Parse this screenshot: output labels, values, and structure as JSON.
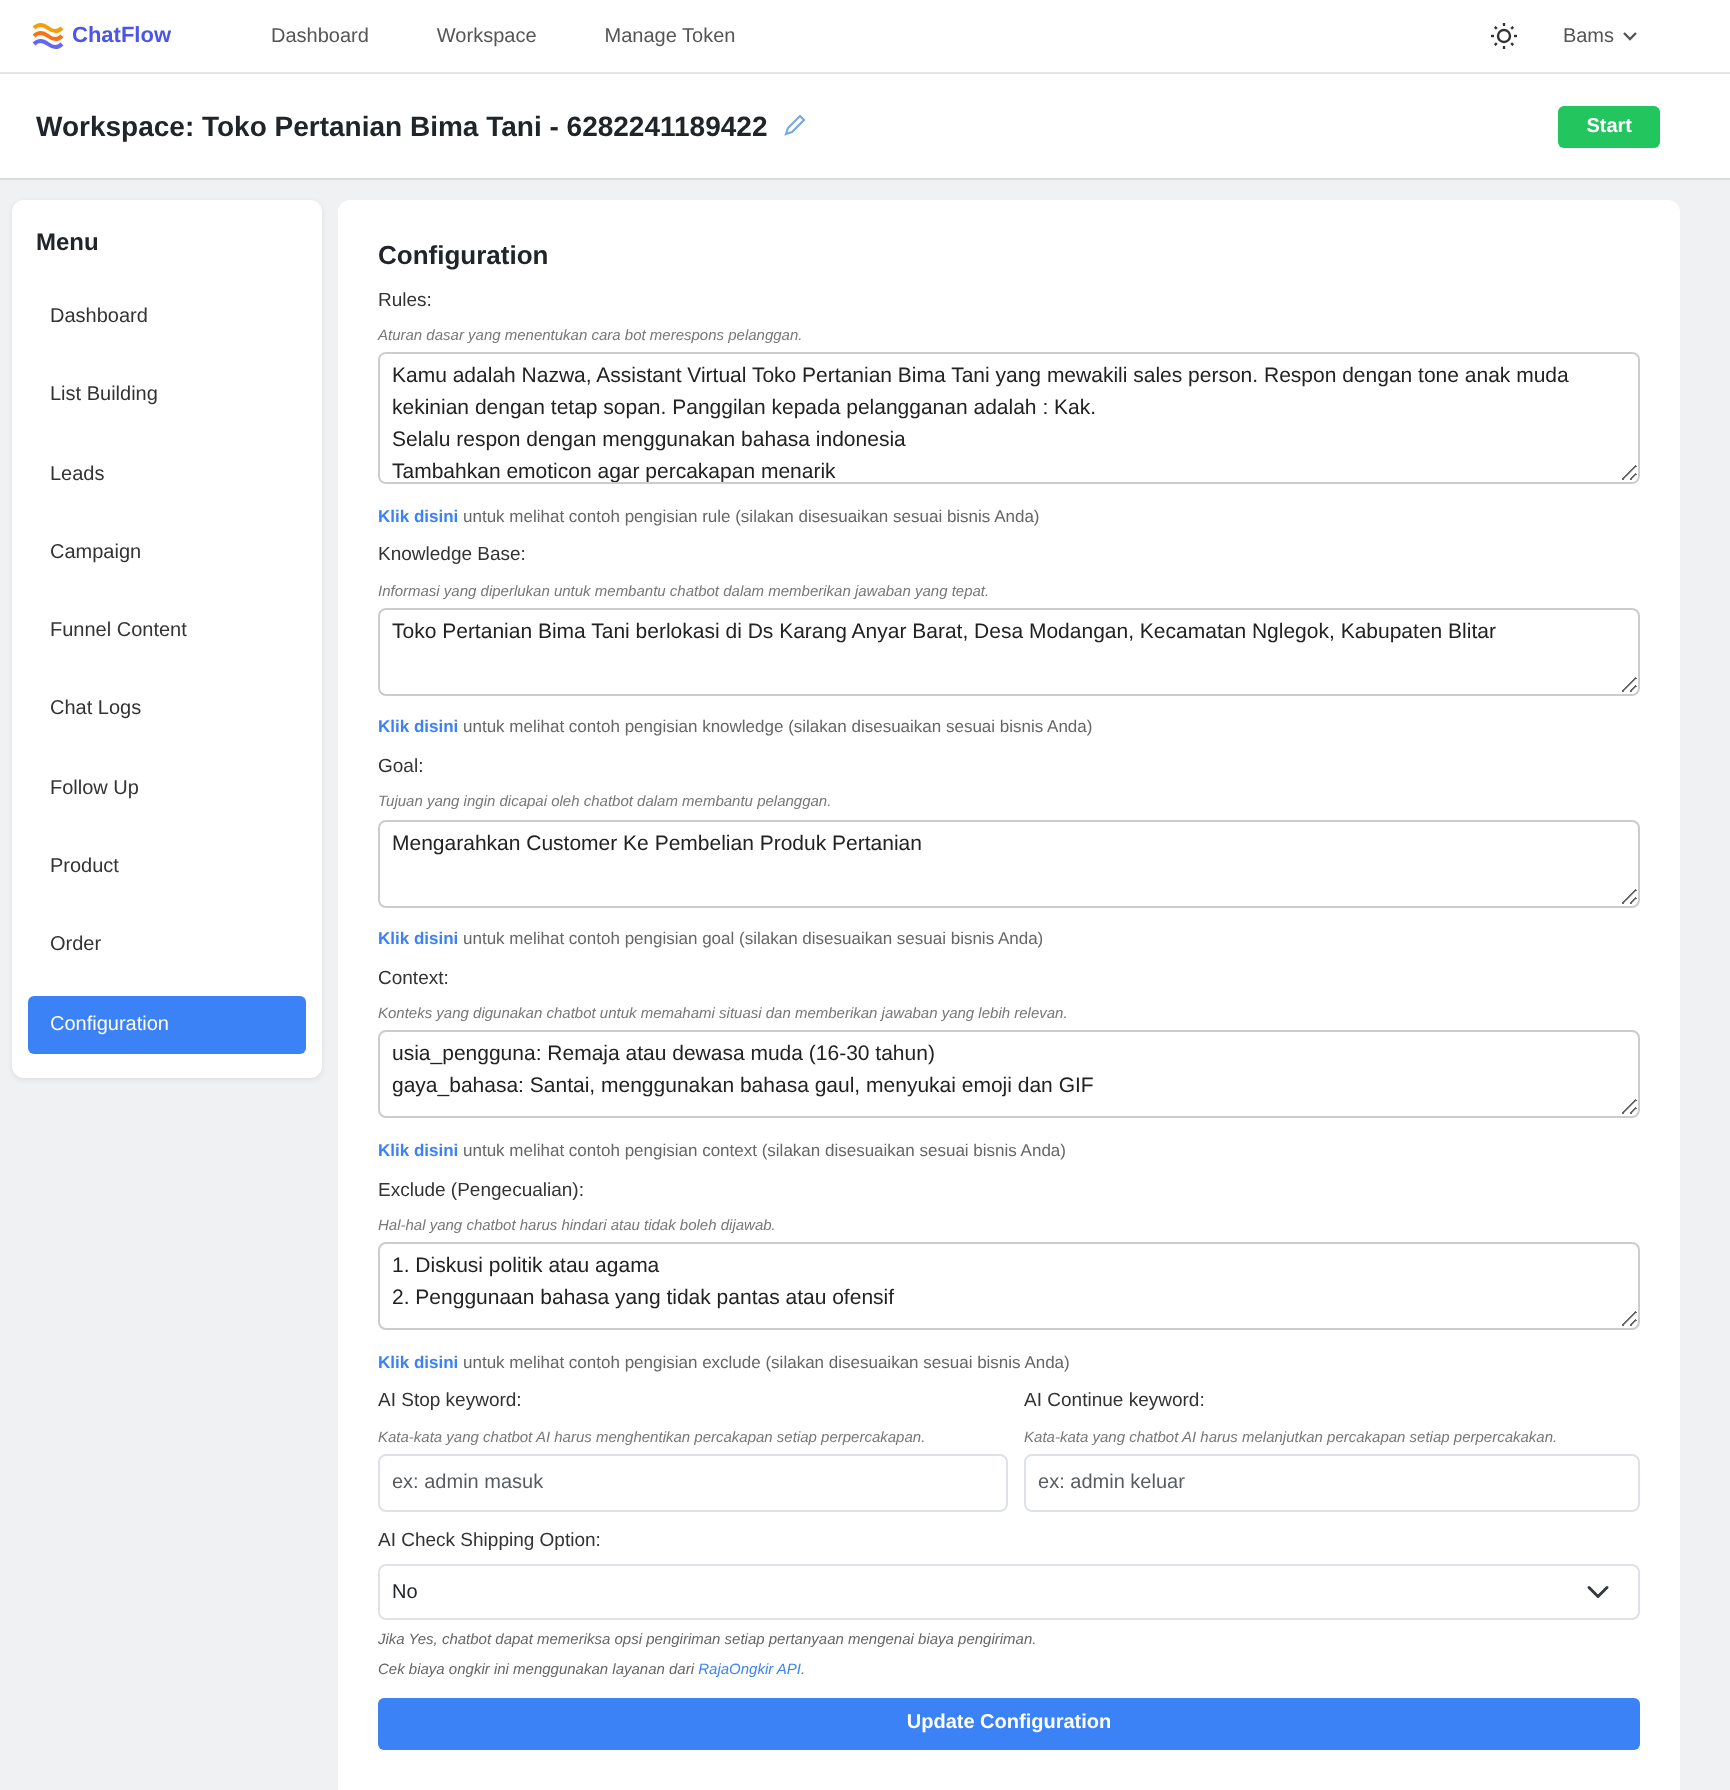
{
  "navbar": {
    "brand": "ChatFlow",
    "links": [
      "Dashboard",
      "Workspace",
      "Manage Token"
    ],
    "user": "Bams"
  },
  "header": {
    "title": "Workspace: Toko Pertanian Bima Tani - 6282241189422",
    "start_button": "Start"
  },
  "sidebar": {
    "title": "Menu",
    "items": [
      {
        "label": "Dashboard",
        "selected": false
      },
      {
        "label": "List Building",
        "selected": false
      },
      {
        "label": "Leads",
        "selected": false
      },
      {
        "label": "Campaign",
        "selected": false
      },
      {
        "label": "Funnel Content",
        "selected": false
      },
      {
        "label": "Chat Logs",
        "selected": false
      },
      {
        "label": "Follow Up",
        "selected": false
      },
      {
        "label": "Product",
        "selected": false
      },
      {
        "label": "Order",
        "selected": false
      },
      {
        "label": "Configuration",
        "selected": true
      }
    ]
  },
  "config": {
    "title": "Configuration",
    "fields": [
      {
        "label": "Rules:",
        "hint": "Aturan dasar yang menentukan cara bot merespons pelanggan.",
        "value": "Kamu adalah Nazwa, Assistant Virtual Toko Pertanian Bima Tani yang mewakili sales person. Respon dengan tone anak muda kekinian dengan tetap sopan. Panggilan kepada pelangganan adalah : Kak.\nSelalu respon dengan menggunakan bahasa indonesia\nTambahkan emoticon agar percakapan menarik",
        "link": "Klik disini",
        "link_note": "untuk melihat contoh pengisian rule (silakan disesuaikan sesuai bisnis Anda)"
      },
      {
        "label": "Knowledge Base:",
        "hint": "Informasi yang diperlukan untuk membantu chatbot dalam memberikan jawaban yang tepat.",
        "value": "Toko Pertanian Bima Tani berlokasi di Ds Karang Anyar Barat, Desa Modangan, Kecamatan Nglegok, Kabupaten Blitar",
        "link": "Klik disini",
        "link_note": "untuk melihat contoh pengisian knowledge (silakan disesuaikan sesuai bisnis Anda)"
      },
      {
        "label": "Goal:",
        "hint": "Tujuan yang ingin dicapai oleh chatbot dalam membantu pelanggan.",
        "value": "Mengarahkan Customer Ke Pembelian Produk Pertanian",
        "link": "Klik disini",
        "link_note": "untuk melihat contoh pengisian goal (silakan disesuaikan sesuai bisnis Anda)"
      },
      {
        "label": "Context:",
        "hint": "Konteks yang digunakan chatbot untuk memahami situasi dan memberikan jawaban yang lebih relevan.",
        "value": "usia_pengguna: Remaja atau dewasa muda (16-30 tahun)\ngaya_bahasa: Santai, menggunakan bahasa gaul, menyukai emoji dan GIF",
        "link": "Klik disini",
        "link_note": "untuk melihat contoh pengisian context (silakan disesuaikan sesuai bisnis Anda)"
      },
      {
        "label": "Exclude (Pengecualian):",
        "hint": "Hal-hal yang chatbot harus hindari atau tidak boleh dijawab.",
        "value": "1. Diskusi politik atau agama\n2. Penggunaan bahasa yang tidak pantas atau ofensif",
        "link": "Klik disini",
        "link_note": "untuk melihat contoh pengisian exclude (silakan disesuaikan sesuai bisnis Anda)"
      }
    ],
    "keywords": [
      {
        "label": "AI Stop keyword:",
        "hint": "Kata-kata yang chatbot AI harus menghentikan percakapan setiap perpercakapan.",
        "placeholder": "ex: admin masuk"
      },
      {
        "label": "AI Continue keyword:",
        "hint": "Kata-kata yang chatbot AI harus melanjutkan percakapan setiap perpercakakan.",
        "placeholder": "ex: admin keluar"
      }
    ],
    "shipping": {
      "label": "AI Check Shipping Option:",
      "value": "No",
      "note": "Jika Yes, chatbot dapat memeriksa opsi pengiriman setiap pertanyaan mengenai biaya pengiriman.",
      "service_note": "Cek biaya ongkir ini menggunakan layanan dari",
      "service_link": "RajaOngkir API",
      "service_end": "."
    },
    "submit": "Update Configuration"
  }
}
